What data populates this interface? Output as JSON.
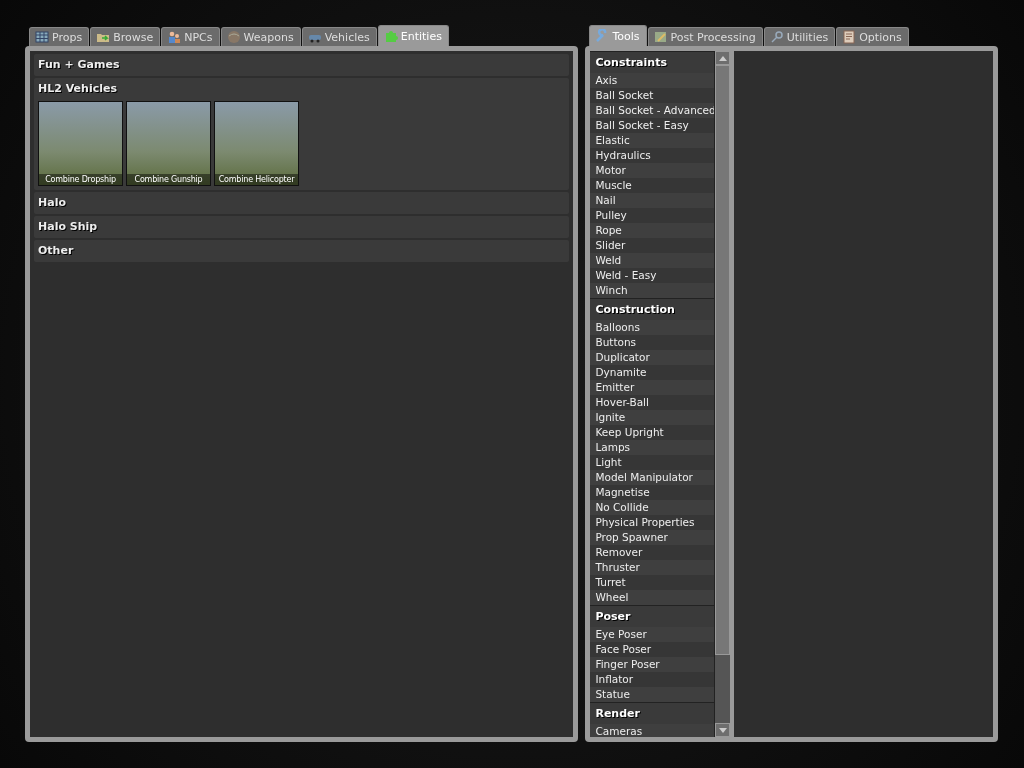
{
  "left_tabs": [
    {
      "label": "Props",
      "selected": false
    },
    {
      "label": "Browse",
      "selected": false
    },
    {
      "label": "NPCs",
      "selected": false
    },
    {
      "label": "Weapons",
      "selected": false
    },
    {
      "label": "Vehicles",
      "selected": false
    },
    {
      "label": "Entities",
      "selected": true
    }
  ],
  "categories": [
    {
      "title": "Fun + Games"
    },
    {
      "title": "HL2 Vehicles",
      "items": [
        {
          "label": "Combine Dropship"
        },
        {
          "label": "Combine Gunship"
        },
        {
          "label": "Combine Helicopter"
        }
      ]
    },
    {
      "title": "Halo"
    },
    {
      "title": "Halo Ship"
    },
    {
      "title": "Other"
    }
  ],
  "right_tabs": [
    {
      "label": "Tools",
      "selected": true
    },
    {
      "label": "Post Processing",
      "selected": false
    },
    {
      "label": "Utilities",
      "selected": false
    },
    {
      "label": "Options",
      "selected": false
    }
  ],
  "tool_groups": [
    {
      "title": "Constraints",
      "items": [
        "Axis",
        "Ball Socket",
        "Ball Socket - Advanced",
        "Ball Socket - Easy",
        "Elastic",
        "Hydraulics",
        "Motor",
        "Muscle",
        "Nail",
        "Pulley",
        "Rope",
        "Slider",
        "Weld",
        "Weld - Easy",
        "Winch"
      ]
    },
    {
      "title": "Construction",
      "items": [
        "Balloons",
        "Buttons",
        "Duplicator",
        "Dynamite",
        "Emitter",
        "Hover-Ball",
        "Ignite",
        "Keep Upright",
        "Lamps",
        "Light",
        "Model Manipulator",
        "Magnetise",
        "No Collide",
        "Physical Properties",
        "Prop Spawner",
        "Remover",
        "Thruster",
        "Turret",
        "Wheel"
      ]
    },
    {
      "title": "Poser",
      "items": [
        "Eye Poser",
        "Face Poser",
        "Finger Poser",
        "Inflator",
        "Statue"
      ]
    },
    {
      "title": "Render",
      "items": [
        "Cameras"
      ]
    }
  ]
}
